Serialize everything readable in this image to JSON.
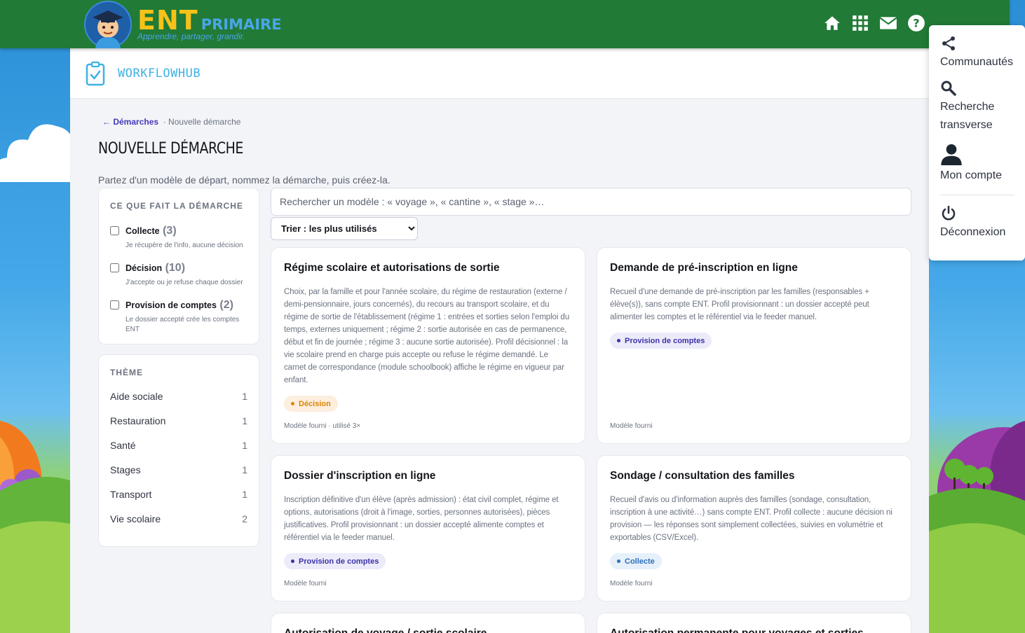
{
  "brand": {
    "ent": "ENT",
    "primaire": "PRIMAIRE",
    "tagline": "Apprendre, partager, grandir."
  },
  "topbar_icons": [
    "home-icon",
    "apps-grid-icon",
    "mail-icon",
    "help-icon"
  ],
  "user_menu": {
    "communities": "Communautés",
    "search": "Recherche transverse",
    "account": "Mon compte",
    "logout": "Déconnexion"
  },
  "app": {
    "name": "WORKFLOWHUB"
  },
  "breadcrumb": {
    "back": "← Démarches",
    "current": "· Nouvelle démarche"
  },
  "page": {
    "title": "NOUVELLE DÉMARCHE",
    "subtitle": "Partez d'un modèle de départ, nommez la démarche, puis créez-la."
  },
  "filters": {
    "heading": "CE QUE FAIT LA DÉMARCHE",
    "items": [
      {
        "label": "Collecte",
        "count": "(3)",
        "desc": "Je récupère de l'info, aucune décision"
      },
      {
        "label": "Décision",
        "count": "(10)",
        "desc": "J'accepte ou je refuse chaque dossier"
      },
      {
        "label": "Provision de comptes",
        "count": "(2)",
        "desc": "Le dossier accepté crée les comptes ENT"
      }
    ]
  },
  "themes": {
    "heading": "THÈME",
    "items": [
      {
        "label": "Aide sociale",
        "count": "1"
      },
      {
        "label": "Restauration",
        "count": "1"
      },
      {
        "label": "Santé",
        "count": "1"
      },
      {
        "label": "Stages",
        "count": "1"
      },
      {
        "label": "Transport",
        "count": "1"
      },
      {
        "label": "Vie scolaire",
        "count": "2"
      }
    ]
  },
  "search": {
    "placeholder": "Rechercher un modèle : « voyage », « cantine », « stage »…"
  },
  "sort": {
    "selected": "Trier : les plus utilisés"
  },
  "templates": [
    {
      "title": "Régime scolaire et autorisations de sortie",
      "desc": "Choix, par la famille et pour l'année scolaire, du régime de restauration (externe / demi-pensionnaire, jours concernés), du recours au transport scolaire, et du régime de sortie de l'établissement (régime 1 : entrées et sorties selon l'emploi du temps, externes uniquement ; régime 2 : sortie autorisée en cas de permanence, début et fin de journée ; régime 3 : aucune sortie autorisée). Profil décisionnel : la vie scolaire prend en charge puis accepte ou refuse le régime demandé. Le carnet de correspondance (module schoolbook) affiche le régime en vigueur par enfant.",
      "badge": "Décision",
      "footer": "Modèle fourni · utilisé 3×"
    },
    {
      "title": "Demande de pré-inscription en ligne",
      "desc": "Recueil d'une demande de pré-inscription par les familles (responsables + élève(s)), sans compte ENT. Profil provisionnant : un dossier accepté peut alimenter les comptes et le référentiel via le feeder manuel.",
      "badge": "Provision de comptes",
      "footer": "Modèle fourni"
    },
    {
      "title": "Dossier d'inscription en ligne",
      "desc": "Inscription définitive d'un élève (après admission) : état civil complet, régime et options, autorisations (droit à l'image, sorties, personnes autorisées), pièces justificatives. Profil provisionnant : un dossier accepté alimente comptes et référentiel via le feeder manuel.",
      "badge": "Provision de comptes",
      "footer": "Modèle fourni"
    },
    {
      "title": "Sondage / consultation des familles",
      "desc": "Recueil d'avis ou d'information auprès des familles (sondage, consultation, inscription à une activité…) sans compte ENT. Profil collecte : aucune décision ni provision — les réponses sont simplement collectées, suivies en volumétrie et exportables (CSV/Excel).",
      "badge": "Collecte",
      "footer": "Modèle fourni"
    },
    {
      "title": "Autorisation de voyage / sortie scolaire",
      "desc": "",
      "badge": "",
      "footer": ""
    },
    {
      "title": "Autorisation permanente pour voyages et sorties",
      "desc": "",
      "badge": "",
      "footer": ""
    }
  ],
  "colors": {
    "topbar": "#217a36",
    "accent": "#4538b8",
    "app_name": "#3fb2e5",
    "decision": "#d9860b",
    "provision": "#3c32a8",
    "collecte": "#2f6fb8"
  }
}
